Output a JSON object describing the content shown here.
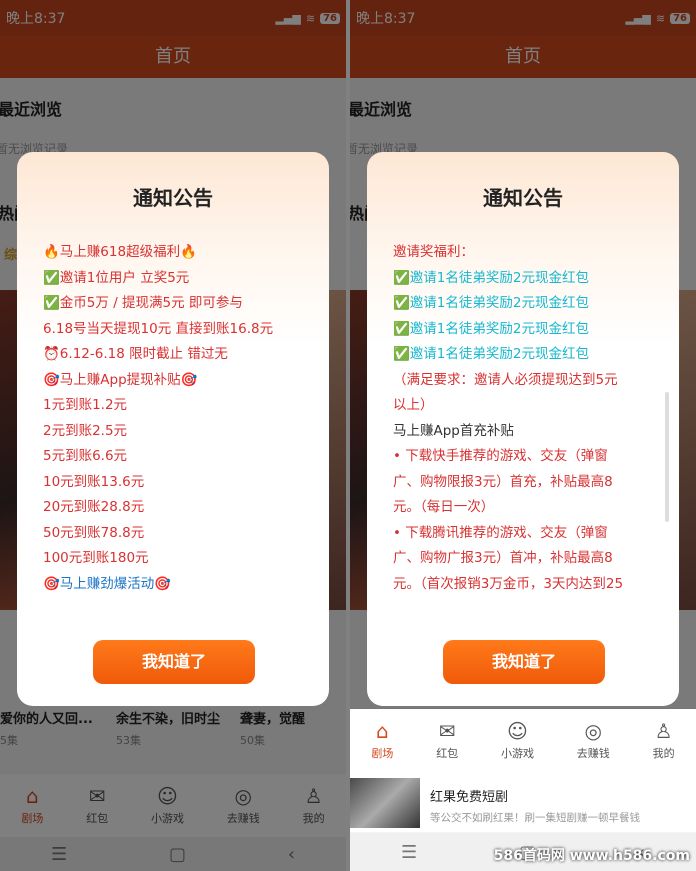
{
  "left": {
    "status": {
      "time": "晚上8:37",
      "battery": "76"
    },
    "header_title": "首页",
    "recent": {
      "title": "最近浏览",
      "empty": "暂无浏览记录"
    },
    "hot_title": "热门",
    "category_short": "综",
    "dramas": [
      {
        "title": "爱你的人又回...",
        "eps": "5集"
      },
      {
        "title": "余生不染，旧时尘",
        "eps": "53集"
      },
      {
        "title": "聋妻，觉醒",
        "eps": "50集"
      }
    ],
    "dialog": {
      "title": "通知公告",
      "lines": [
        {
          "text": "🔥马上赚618超级福利🔥",
          "color": "red"
        },
        {
          "text": "✅邀请1位用户 立奖5元",
          "color": "red"
        },
        {
          "text": "✅金币5万 / 提现满5元 即可参与",
          "color": "red"
        },
        {
          "text": "6.18号当天提现10元 直接到账16.8元",
          "color": "red"
        },
        {
          "text": "⏰6.12-6.18 限时截止 错过无",
          "color": "red"
        },
        {
          "text": "🎯马上赚App提现补贴🎯",
          "color": "red"
        },
        {
          "text": "1元到账1.2元",
          "color": "red"
        },
        {
          "text": "2元到账2.5元",
          "color": "red"
        },
        {
          "text": "5元到账6.6元",
          "color": "red"
        },
        {
          "text": "10元到账13.6元",
          "color": "red"
        },
        {
          "text": "20元到账28.8元",
          "color": "red"
        },
        {
          "text": "50元到账78.8元",
          "color": "red"
        },
        {
          "text": "100元到账180元",
          "color": "red"
        },
        {
          "text": "🎯马上赚劲爆活动🎯",
          "color": "blue"
        }
      ],
      "button": "我知道了"
    },
    "tabs": [
      "剧场",
      "红包",
      "小游戏",
      "去赚钱",
      "我的"
    ]
  },
  "right": {
    "status": {
      "time": "晚上8:37",
      "battery": "76"
    },
    "header_title": "首页",
    "recent": {
      "title": "最近浏览",
      "empty": "暂无浏览记录"
    },
    "hot_title": "热门",
    "dialog": {
      "title": "通知公告",
      "lines": [
        {
          "text": "邀请奖福利：",
          "color": "red"
        },
        {
          "text": "✅邀请1名徒弟奖励2元现金红包",
          "color": "cyan"
        },
        {
          "text": "✅邀请1名徒弟奖励2元现金红包",
          "color": "cyan"
        },
        {
          "text": "✅邀请1名徒弟奖励2元现金红包",
          "color": "cyan"
        },
        {
          "text": "✅邀请1名徒弟奖励2元现金红包",
          "color": "cyan"
        },
        {
          "text": "（满足要求：邀请人必须提现达到5元",
          "color": "red"
        },
        {
          "text": "以上）",
          "color": "red"
        },
        {
          "text": "马上赚App首充补贴",
          "color": "dark"
        },
        {
          "text": "• 下载快手推荐的游戏、交友（弹窗",
          "color": "red"
        },
        {
          "text": "广、购物限报3元）首充，补贴最高8",
          "color": "red"
        },
        {
          "text": "元。（每日一次）",
          "color": "red"
        },
        {
          "text": "• 下载腾讯推荐的游戏、交友（弹窗",
          "color": "red"
        },
        {
          "text": "广、购物广报3元）首冲，补贴最高8",
          "color": "red"
        },
        {
          "text": "元。（首次报销3万金币，3天内达到25",
          "color": "red"
        }
      ],
      "button": "我知道了"
    },
    "tabs": [
      "剧场",
      "红包",
      "小游戏",
      "去赚钱",
      "我的"
    ],
    "ad": {
      "title": "红果免费短剧",
      "desc": "等公交不如刷红果！刷一集短剧赚一顿早餐钱"
    },
    "watermark": "586首码网 www.h586.com"
  },
  "colors": {
    "brand": "#d44a1f",
    "red": "#d83232",
    "blue": "#1a74c7",
    "cyan": "#17b8cf",
    "button": "#f5620f"
  }
}
